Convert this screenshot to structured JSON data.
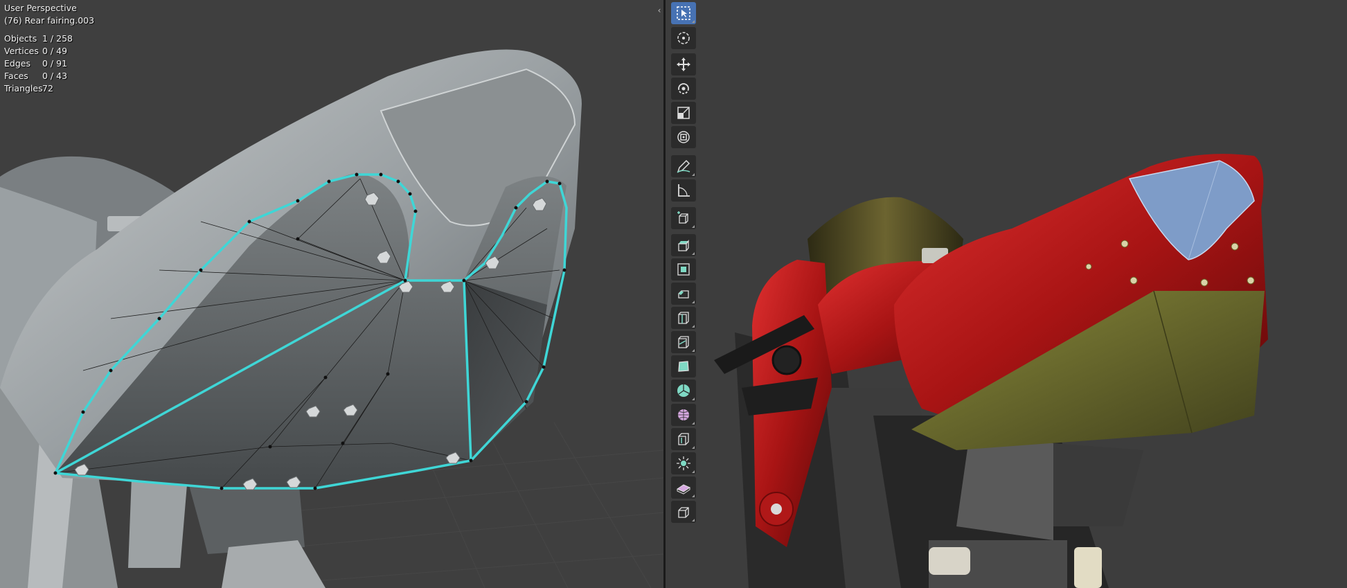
{
  "viewport_left": {
    "mode": "User Perspective",
    "active_object": "(76) Rear fairing.003",
    "stats": [
      {
        "label": "Objects",
        "value": "1 / 258"
      },
      {
        "label": "Vertices",
        "value": "0 / 49"
      },
      {
        "label": "Edges",
        "value": "0 / 91"
      },
      {
        "label": "Faces",
        "value": "0 / 43"
      },
      {
        "label": "Triangles",
        "value": "72"
      }
    ],
    "collapse_glyph": "‹"
  },
  "toolbar": {
    "tools": [
      {
        "icon": "select-box-icon",
        "active": true
      },
      {
        "icon": "cursor-icon"
      },
      {
        "icon": "move-icon"
      },
      {
        "icon": "rotate-icon"
      },
      {
        "icon": "scale-icon"
      },
      {
        "icon": "transform-icon"
      },
      {
        "icon": "annotate-icon"
      },
      {
        "icon": "measure-icon"
      },
      {
        "icon": "add-cube-icon"
      },
      {
        "icon": "extrude-region-icon"
      },
      {
        "icon": "inset-faces-icon"
      },
      {
        "icon": "bevel-icon"
      },
      {
        "icon": "loop-cut-icon"
      },
      {
        "icon": "knife-icon"
      },
      {
        "icon": "poly-build-icon"
      },
      {
        "icon": "spin-icon"
      },
      {
        "icon": "smooth-icon"
      },
      {
        "icon": "edge-slide-icon"
      },
      {
        "icon": "shrink-fatten-icon"
      },
      {
        "icon": "shear-icon"
      },
      {
        "icon": "rip-region-icon"
      }
    ]
  },
  "colors": {
    "selection": "#3fd6d6",
    "active_tool": "#4772b3",
    "tool_bg": "#2b2b2b",
    "fairing_red": "#b01818",
    "seat_blue": "#7e9cc8",
    "panel_gold": "#6b6a2e"
  }
}
